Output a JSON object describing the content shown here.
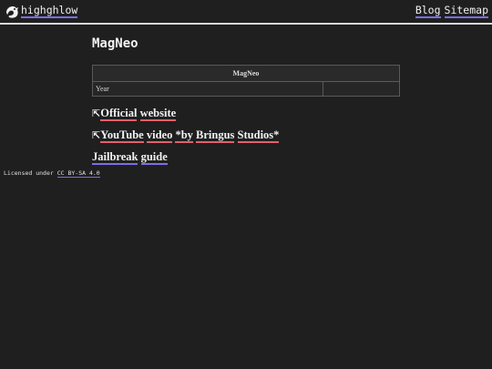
{
  "header": {
    "site_name": "highghlow",
    "nav": [
      "Blog",
      "Sitemap"
    ]
  },
  "page": {
    "title": "MagNeo",
    "infobox": {
      "heading": "MagNeo",
      "rows": [
        {
          "label": "Year",
          "value": ""
        }
      ]
    },
    "links": [
      {
        "prefix": "⇱",
        "parts": [
          "Official",
          "website"
        ],
        "external": true
      },
      {
        "prefix": "⇱",
        "parts": [
          "YouTube",
          "video",
          "*by",
          "Bringus",
          "Studios*"
        ],
        "external": true
      },
      {
        "prefix": "",
        "parts": [
          "Jailbreak",
          "guide"
        ],
        "external": false
      }
    ]
  },
  "footer": {
    "text": "Licensed under",
    "license_link": "CC BY-SA 4.0"
  },
  "colors": {
    "background": "#1f1f1f",
    "internal_link_underline": "#7b6fe6",
    "external_link_underline": "#e0616b"
  }
}
